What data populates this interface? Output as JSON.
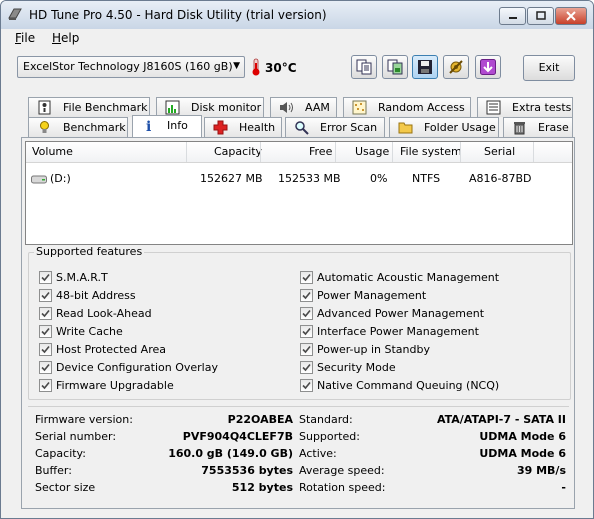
{
  "window": {
    "title": "HD Tune Pro 4.50 - Hard Disk Utility (trial version)"
  },
  "menu": [
    {
      "label": "File",
      "accel": "F",
      "rest": "ile"
    },
    {
      "label": "Help",
      "accel": "H",
      "rest": "elp"
    }
  ],
  "toolbar": {
    "drive": "ExcelStor Technology J8160S (160 gB)",
    "temperature": "30°C",
    "exit_label": "Exit",
    "buttons": [
      "copy-text-icon",
      "copy-screenshot-icon",
      "save-icon",
      "options-icon",
      "download-icon"
    ]
  },
  "tabs_row1": [
    "File Benchmark",
    "Disk monitor",
    "AAM",
    "Random Access",
    "Extra tests"
  ],
  "tabs_row2": [
    "Benchmark",
    "Info",
    "Health",
    "Error Scan",
    "Folder Usage",
    "Erase"
  ],
  "active_tab": "Info",
  "volumes": {
    "columns": [
      "Volume",
      "Capacity",
      "Free",
      "Usage",
      "File system",
      "Serial"
    ],
    "rows": [
      {
        "volume": "(D:)",
        "capacity": "152627 MB",
        "free": "152533 MB",
        "usage": "0%",
        "filesystem": "NTFS",
        "serial": "A816-87BD"
      }
    ]
  },
  "features": {
    "legend": "Supported features",
    "left": [
      "S.M.A.R.T",
      "48-bit Address",
      "Read Look-Ahead",
      "Write Cache",
      "Host Protected Area",
      "Device Configuration Overlay",
      "Firmware Upgradable"
    ],
    "right": [
      "Automatic Acoustic Management",
      "Power Management",
      "Advanced Power Management",
      "Interface Power Management",
      "Power-up in Standby",
      "Security Mode",
      "Native Command Queuing (NCQ)"
    ]
  },
  "info": {
    "left": [
      {
        "label": "Firmware version:",
        "value": "P22OABEA"
      },
      {
        "label": "Serial number:",
        "value": "PVF904Q4CLEF7B"
      },
      {
        "label": "Capacity:",
        "value": "160.0 gB (149.0 GB)"
      },
      {
        "label": "Buffer:",
        "value": "7553536 bytes"
      },
      {
        "label": "Sector size",
        "value": "512 bytes"
      }
    ],
    "right": [
      {
        "label": "Standard:",
        "value": "ATA/ATAPI-7 - SATA II"
      },
      {
        "label": "Supported:",
        "value": "UDMA Mode 6"
      },
      {
        "label": "Active:",
        "value": "UDMA Mode 6"
      },
      {
        "label": "Average speed:",
        "value": "39 MB/s"
      },
      {
        "label": "Rotation speed:",
        "value": "-"
      }
    ]
  }
}
